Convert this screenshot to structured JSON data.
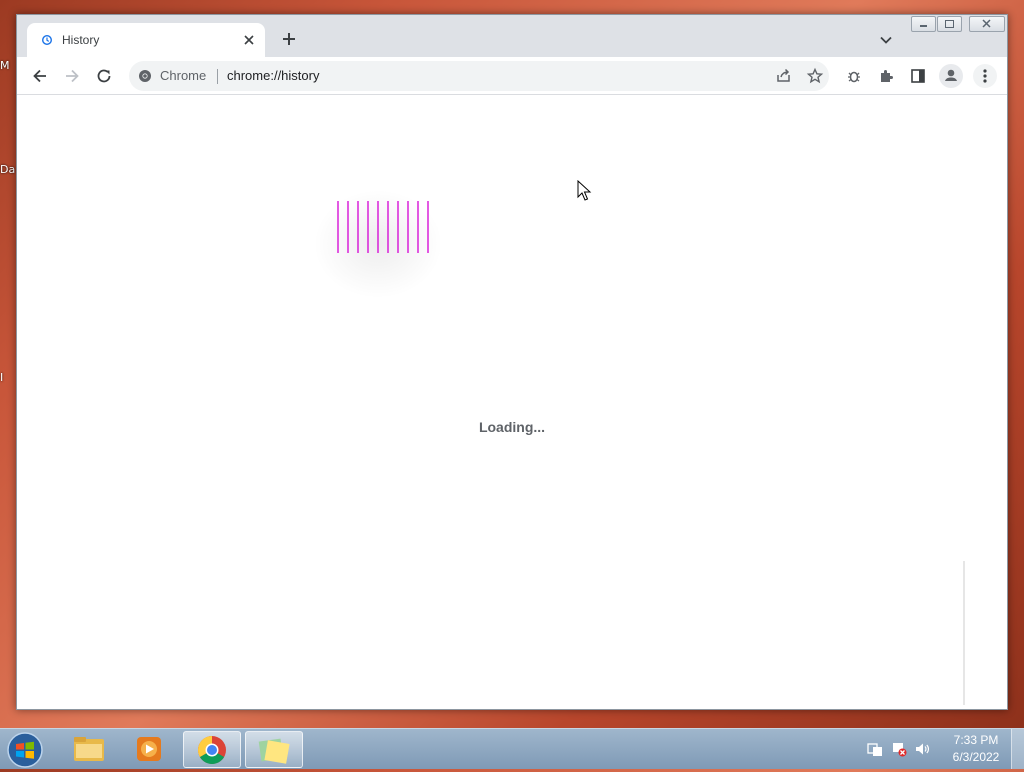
{
  "desktop": {
    "fragments": [
      "M",
      "Da",
      "I"
    ]
  },
  "browser": {
    "tab": {
      "title": "History",
      "favicon": "history-icon"
    },
    "address_bar": {
      "chip": "Chrome",
      "url": "chrome://history"
    },
    "content": {
      "status": "Loading..."
    }
  },
  "taskbar": {
    "apps": [
      "windows-explorer",
      "media-player",
      "chrome",
      "sticky-notes"
    ],
    "clock": {
      "time": "7:33 PM",
      "date": "6/3/2022"
    }
  },
  "colors": {
    "accent": "#1a73e8",
    "loader": "#d400d4"
  }
}
